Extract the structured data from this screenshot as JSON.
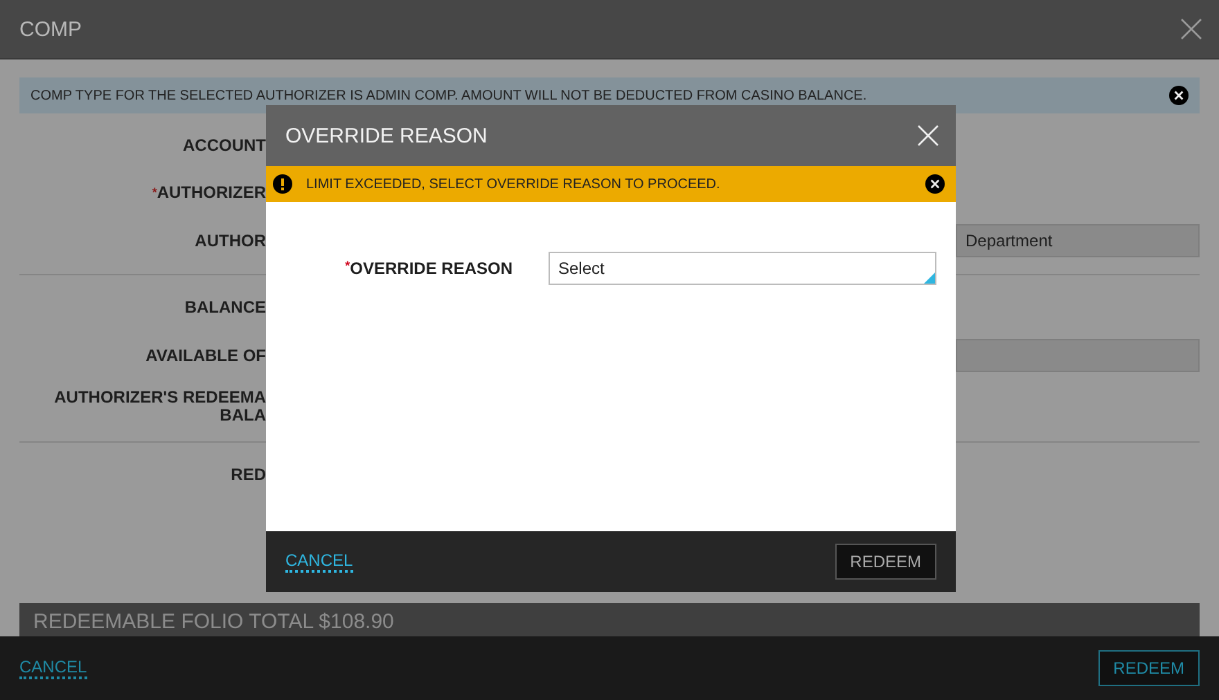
{
  "window": {
    "title": "COMP"
  },
  "info_banner": {
    "text": "COMP TYPE FOR THE SELECTED AUTHORIZER IS ADMIN COMP. AMOUNT WILL NOT BE DEDUCTED FROM CASINO BALANCE."
  },
  "form": {
    "sections": [
      {
        "rows": [
          {
            "kind": "label",
            "lines": [
              "ACCOUNT"
            ]
          },
          {
            "kind": "label",
            "required_mark": "*",
            "lines": [
              "AUTHORIZER"
            ]
          },
          {
            "kind": "field",
            "lines": [
              "AUTHOR"
            ],
            "value": "Department"
          }
        ]
      },
      {
        "rows": [
          {
            "kind": "label",
            "lines": [
              "BALANCE"
            ]
          },
          {
            "kind": "field",
            "lines": [
              "AVAILABLE OF"
            ]
          },
          {
            "kind": "label",
            "lines": [
              "AUTHORIZER'S REDEEMA",
              "BALA"
            ]
          }
        ]
      },
      {
        "rows": [
          {
            "kind": "label",
            "lines": [
              "RED"
            ]
          }
        ]
      }
    ]
  },
  "folio_total": "REDEEMABLE FOLIO TOTAL $108.90",
  "footer": {
    "cancel": "CANCEL",
    "redeem": "REDEEM"
  },
  "dialog": {
    "title": "OVERRIDE REASON",
    "warning": "LIMIT EXCEEDED, SELECT OVERRIDE REASON TO PROCEED.",
    "field": {
      "required_mark": "*",
      "label": "OVERRIDE REASON",
      "value": "Select"
    },
    "cancel": "CANCEL",
    "redeem": "REDEEM"
  }
}
